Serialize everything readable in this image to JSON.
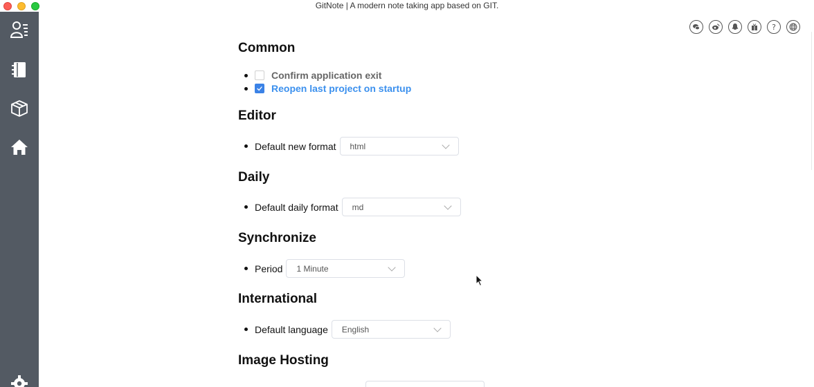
{
  "window": {
    "title": "GitNote | A modern note taking app based on GIT."
  },
  "sidebar": {
    "items": [
      {
        "icon": "user-list-icon"
      },
      {
        "icon": "notebook-icon"
      },
      {
        "icon": "box-icon"
      },
      {
        "icon": "home-icon"
      },
      {
        "icon": "gear-icon"
      }
    ]
  },
  "share": {
    "icons": [
      "wechat-icon",
      "weibo-icon",
      "qq-icon",
      "gift-icon",
      "help-icon",
      "globe-icon"
    ],
    "help_glyph": "?"
  },
  "sections": {
    "common": {
      "title": "Common",
      "confirm_exit": {
        "label": "Confirm application exit",
        "checked": false
      },
      "reopen_last": {
        "label": "Reopen last project on startup",
        "checked": true
      }
    },
    "editor": {
      "title": "Editor",
      "label": "Default new format",
      "value": "html"
    },
    "daily": {
      "title": "Daily",
      "label": "Default daily format",
      "value": "md"
    },
    "synchronize": {
      "title": "Synchronize",
      "label": "Period",
      "value": "1 Minute"
    },
    "international": {
      "title": "International",
      "label": "Default language",
      "value": "English"
    },
    "image_hosting": {
      "title": "Image Hosting"
    }
  },
  "colors": {
    "sidebar": "#535a63",
    "accent": "#3b90ee"
  }
}
